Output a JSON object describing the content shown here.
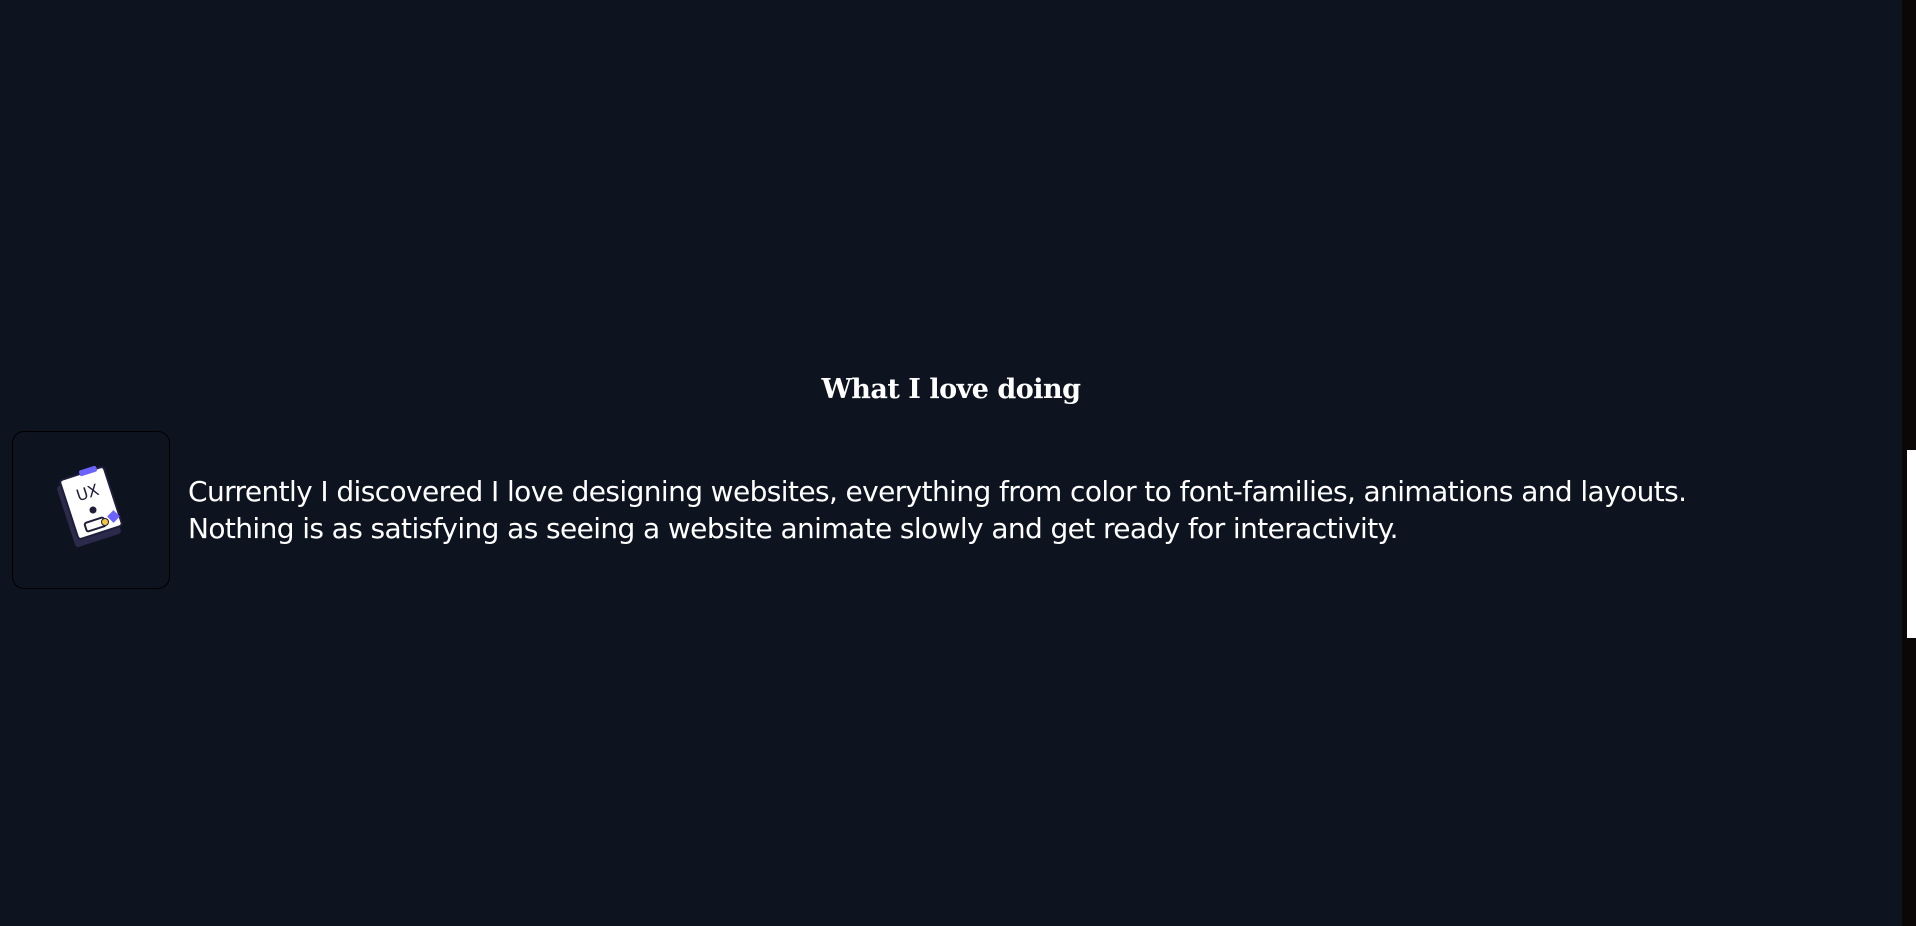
{
  "section": {
    "title": "What I love doing"
  },
  "card": {
    "icon": "ux-design-icon",
    "icon_text": "UX",
    "description_line1": "Currently I discovered I love designing websites, everything from color to font-families, animations and layouts.",
    "description_line2": "Nothing is as satisfying as seeing a website animate slowly and get ready for interactivity."
  },
  "colors": {
    "background": "#0e1320",
    "text": "#ffffff",
    "icon_accent": "#6c63ff",
    "icon_highlight": "#f5c542"
  }
}
